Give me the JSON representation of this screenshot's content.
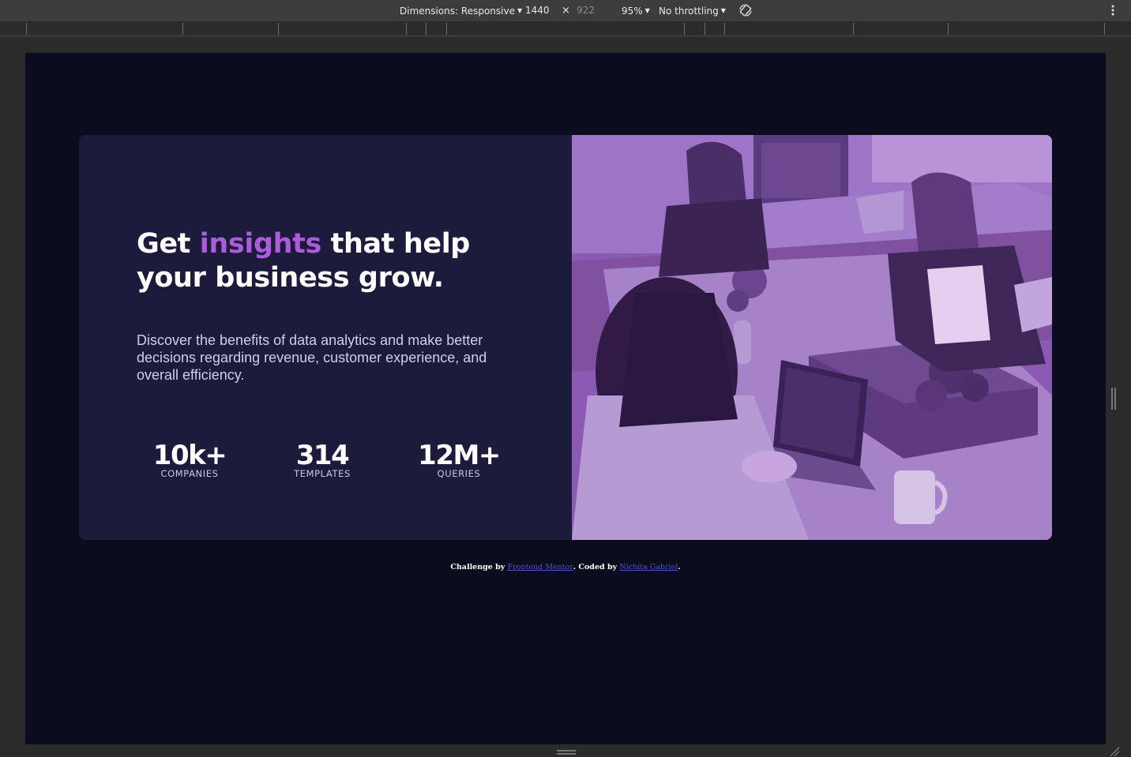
{
  "devtools": {
    "dimensions_label": "Dimensions: Responsive",
    "width_value": "1440",
    "times_symbol": "×",
    "height_value": "922",
    "zoom": "95%",
    "throttling": "No throttling",
    "icons": [
      "rotate-icon",
      "more-options-icon"
    ]
  },
  "hero": {
    "title_part1": "Get",
    "title_accent": "insights",
    "title_part2": "that help your business grow.",
    "description": "Discover the benefits of data analytics and make better decisions regarding revenue, customer experience, and overall efficiency.",
    "stats": [
      {
        "value": "10k+",
        "label": "COMPANIES"
      },
      {
        "value": "314",
        "label": "TEMPLATES"
      },
      {
        "value": "12M+",
        "label": "QUERIES"
      }
    ]
  },
  "footer": {
    "prefix": "Challenge by",
    "mentor_link": "Frontend Mentor",
    "middle": ". Coded by",
    "author_link": "Nichita Gabriel",
    "suffix": "."
  },
  "colors": {
    "page_bg": "#0b0c1e",
    "card_bg": "#1c1b3c",
    "accent": "#ab5cdb",
    "image_tint": "#8a58b6",
    "link": "#4a55c6"
  }
}
